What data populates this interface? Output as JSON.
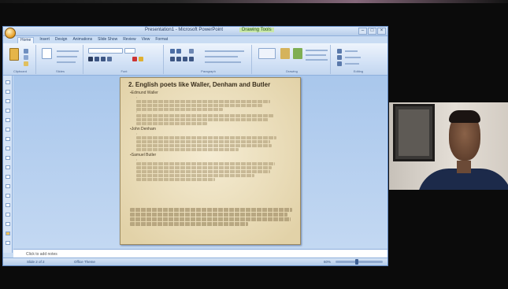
{
  "window": {
    "title": "Presentation1 - Microsoft PowerPoint",
    "context_tab": "Drawing Tools",
    "controls": [
      "–",
      "□",
      "×"
    ]
  },
  "ribbon_tabs": [
    "Home",
    "Insert",
    "Design",
    "Animations",
    "Slide Show",
    "Review",
    "View",
    "Format"
  ],
  "ribbon_groups": [
    "Clipboard",
    "Slides",
    "Font",
    "Paragraph",
    "Drawing",
    "Editing"
  ],
  "slide": {
    "title": "2. English poets like Waller, Denham and Butler",
    "poets": [
      "Edmund Waller",
      "John Denham",
      "Samuel Butler"
    ],
    "summary": "These three, by no means the most notable poets of the age, are small (English) models on... of... poetic genres as a ...ical ... ... poem and ... ...dies as a parody."
  },
  "notes": {
    "placeholder": "Click to add notes"
  },
  "status": {
    "slide": "Slide 2 of 2",
    "theme": "Office Theme",
    "zoom": "60%",
    "zoom_fraction": 0.45
  }
}
